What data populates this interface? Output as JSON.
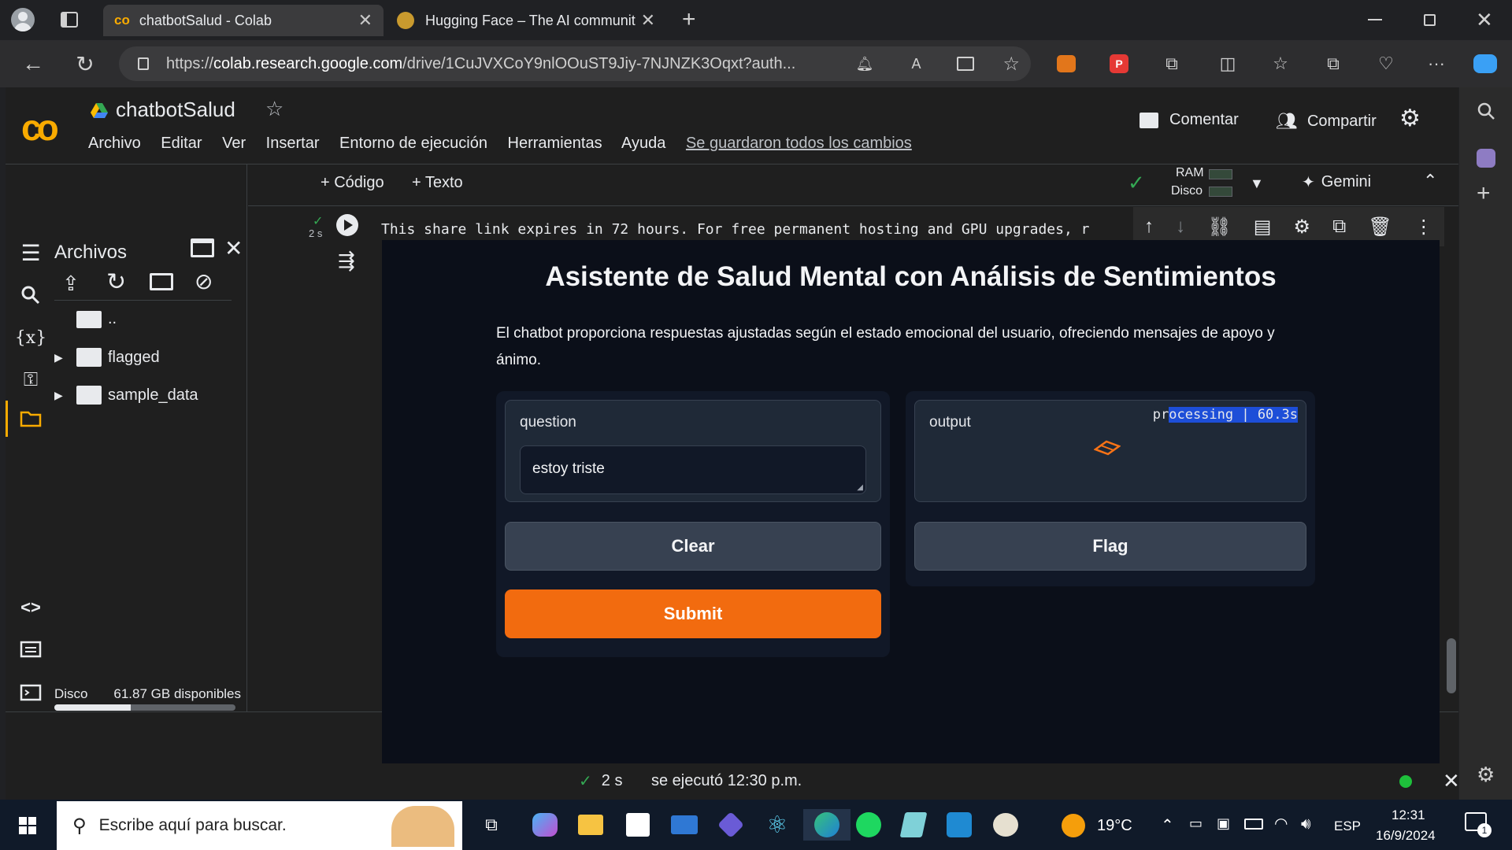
{
  "browser": {
    "tabs": [
      {
        "title": "chatbotSalud - Colab"
      },
      {
        "title": "Hugging Face – The AI communit"
      }
    ],
    "url_prefix": "https://",
    "url_host": "colab.research.google.com",
    "url_path": "/drive/1CuJVXCoY9nlOOuST9Jiy-7NJNZK3Oqxt?auth..."
  },
  "colab": {
    "notebook_title": "chatbotSalud",
    "menu": [
      "Archivo",
      "Editar",
      "Ver",
      "Insertar",
      "Entorno de ejecución",
      "Herramientas",
      "Ayuda"
    ],
    "saved_status": "Se guardaron todos los cambios",
    "comment_label": "Comentar",
    "share_label": "Compartir",
    "add_code_label": "+ Código",
    "add_text_label": "+ Texto",
    "ram_label": "RAM",
    "disk_label": "Disco",
    "gemini_label": "Gemini",
    "cell_time": "2 s",
    "cell_output_line": "This share link expires in 72 hours. For free permanent hosting and GPU upgrades, r",
    "status_time": "2 s",
    "status_ran": "se ejecutó 12:30 p.m."
  },
  "files_panel": {
    "title": "Archivos",
    "tree": [
      {
        "name": ".."
      },
      {
        "name": "flagged"
      },
      {
        "name": "sample_data"
      }
    ],
    "disk_label": "Disco",
    "disk_available": "61.87 GB disponibles",
    "disk_used_fraction": 0.42
  },
  "app": {
    "title": "Asistente de Salud Mental con Análisis de Sentimientos",
    "description": "El chatbot proporciona respuestas ajustadas según el estado emocional del usuario, ofreciendo mensajes de apoyo y ánimo.",
    "question_label": "question",
    "question_value": "estoy triste",
    "output_label": "output",
    "processing_prefix": "pr",
    "processing_rest": "ocessing | 60.3s",
    "clear_label": "Clear",
    "submit_label": "Submit",
    "flag_label": "Flag",
    "colors": {
      "submit": "#f26b0f",
      "bg": "#0b0f19",
      "panel": "#1f2937"
    }
  },
  "taskbar": {
    "search_placeholder": "Escribe aquí para buscar.",
    "weather": "19°C",
    "language": "ESP",
    "time": "12:31",
    "date": "16/9/2024",
    "notification_count": "1"
  }
}
